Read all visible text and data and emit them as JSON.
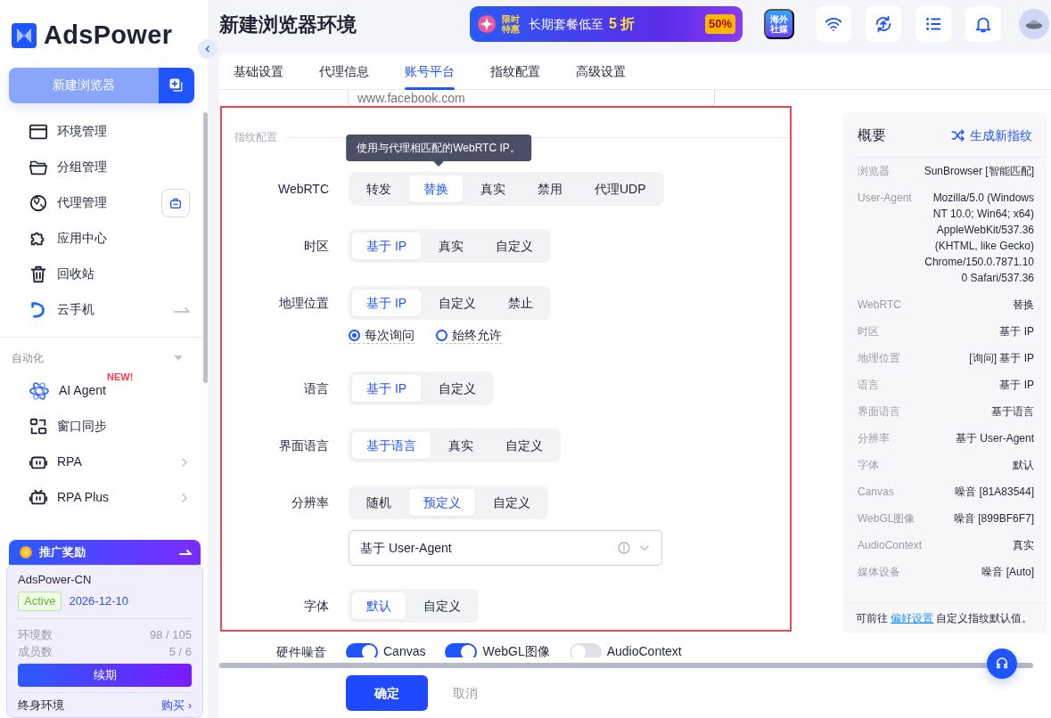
{
  "sidebar": {
    "logo": "AdsPower",
    "new_button": "新建浏览器",
    "nav": [
      {
        "label": "环境管理",
        "kind": "plain"
      },
      {
        "label": "分组管理",
        "kind": "plain"
      },
      {
        "label": "代理管理",
        "kind": "shop"
      },
      {
        "label": "应用中心",
        "kind": "plain"
      },
      {
        "label": "回收站",
        "kind": "plain"
      },
      {
        "label": "云手机",
        "kind": "arrow"
      }
    ],
    "section": "自动化",
    "auto_nav": [
      {
        "label": "AI Agent",
        "badge": "NEW!",
        "kind": "plain"
      },
      {
        "label": "窗口同步",
        "kind": "plain"
      },
      {
        "label": "RPA",
        "kind": "chevron"
      },
      {
        "label": "RPA Plus",
        "kind": "chevron"
      }
    ],
    "promo": {
      "title": "推广奖励",
      "account": "AdsPower-CN",
      "status": "Active",
      "date": "2026-12-10",
      "stats": [
        {
          "label": "环境数",
          "value": "98 / 105"
        },
        {
          "label": "成员数",
          "value": "5 / 6"
        }
      ],
      "renew": "续期",
      "lifetime": "终身环境",
      "buy": "购买 ›"
    }
  },
  "header": {
    "title": "新建浏览器环境",
    "banner_tag": "限时特惠",
    "banner_text": "长期套餐低至",
    "banner_discount": "5 折",
    "banner_badge": "50%",
    "social": "海外社媒"
  },
  "tabs": [
    {
      "label": "基础设置",
      "selected": false
    },
    {
      "label": "代理信息",
      "selected": false
    },
    {
      "label": "账号平台",
      "selected": true
    },
    {
      "label": "指纹配置",
      "selected": false
    },
    {
      "label": "高级设置",
      "selected": false
    }
  ],
  "platform_field": {
    "placeholder": "www.facebook.com"
  },
  "fingerprint": {
    "heading": "指纹配置",
    "rows": [
      {
        "label": "WebRTC",
        "kind": "segmented",
        "tooltip": "使用与代理相匹配的WebRTC IP。",
        "options": [
          {
            "label": "转发",
            "selected": false
          },
          {
            "label": "替换",
            "selected": true
          },
          {
            "label": "真实",
            "selected": false
          },
          {
            "label": "禁用",
            "selected": false
          },
          {
            "label": "代理UDP",
            "selected": false
          }
        ]
      },
      {
        "label": "时区",
        "kind": "segmented",
        "options": [
          {
            "label": "基于 IP",
            "selected": true
          },
          {
            "label": "真实",
            "selected": false
          },
          {
            "label": "自定义",
            "selected": false
          }
        ]
      },
      {
        "label": "地理位置",
        "kind": "segmented",
        "options": [
          {
            "label": "基于 IP",
            "selected": true
          },
          {
            "label": "自定义",
            "selected": false
          },
          {
            "label": "禁止",
            "selected": false
          }
        ],
        "radios": [
          {
            "label": "每次询问",
            "selected": true
          },
          {
            "label": "始终允许",
            "selected": false
          }
        ]
      },
      {
        "label": "语言",
        "kind": "segmented",
        "options": [
          {
            "label": "基于 IP",
            "selected": true
          },
          {
            "label": "自定义",
            "selected": false
          }
        ]
      },
      {
        "label": "界面语言",
        "kind": "segmented",
        "options": [
          {
            "label": "基于语言",
            "selected": true
          },
          {
            "label": "真实",
            "selected": false
          },
          {
            "label": "自定义",
            "selected": false
          }
        ]
      },
      {
        "label": "分辨率",
        "kind": "segmented",
        "options": [
          {
            "label": "随机",
            "selected": false
          },
          {
            "label": "预定义",
            "selected": true
          },
          {
            "label": "自定义",
            "selected": false
          }
        ],
        "select": "基于 User-Agent"
      },
      {
        "label": "字体",
        "kind": "segmented",
        "options": [
          {
            "label": "默认",
            "selected": true
          },
          {
            "label": "自定义",
            "selected": false
          }
        ]
      }
    ]
  },
  "hardware_noise": {
    "label": "硬件噪音",
    "toggles": [
      {
        "label": "Canvas",
        "on": true
      },
      {
        "label": "WebGL图像",
        "on": true
      },
      {
        "label": "AudioContext",
        "on": false
      }
    ]
  },
  "summary": {
    "title": "概要",
    "action": "生成新指纹",
    "rows": [
      {
        "label": "浏览器",
        "value": "SunBrowser [智能匹配]"
      },
      {
        "label": "User-Agent",
        "value": "Mozilla/5.0 (Windows NT 10.0; Win64; x64) AppleWebKit/537.36 (KHTML, like Gecko) Chrome/150.0.7871.100 Safari/537.36"
      },
      {
        "label": "WebRTC",
        "value": "替换"
      },
      {
        "label": "时区",
        "value": "基于 IP"
      },
      {
        "label": "地理位置",
        "value": "[询问] 基于 IP"
      },
      {
        "label": "语言",
        "value": "基于 IP"
      },
      {
        "label": "界面语言",
        "value": "基于语言"
      },
      {
        "label": "分辨率",
        "value": "基于 User-Agent"
      },
      {
        "label": "字体",
        "value": "默认"
      },
      {
        "label": "Canvas",
        "value": "噪音 [81A83544]"
      },
      {
        "label": "WebGL图像",
        "value": "噪音 [899BF6F7]"
      },
      {
        "label": "AudioContext",
        "value": "真实"
      },
      {
        "label": "媒体设备",
        "value": "噪音 [Auto]"
      }
    ],
    "footer_before": "可前往",
    "footer_link": "偏好设置",
    "footer_after": "自定义指纹默认值。"
  },
  "footer": {
    "confirm": "确定",
    "cancel": "取消"
  }
}
